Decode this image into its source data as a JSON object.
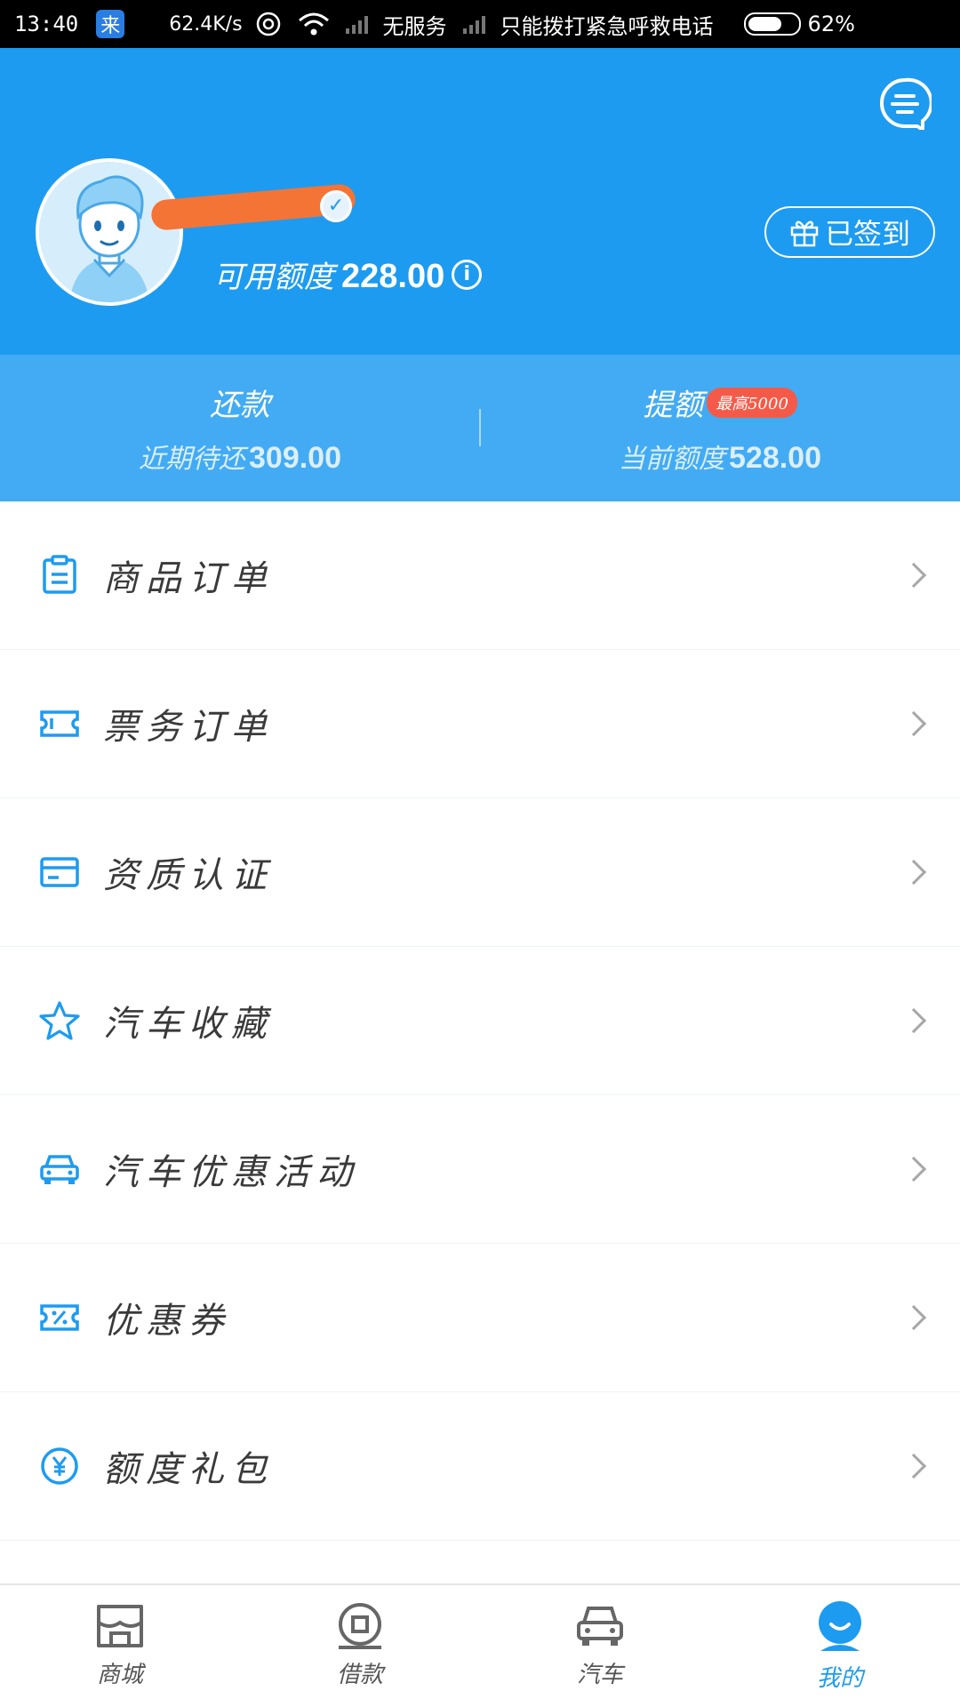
{
  "status_bar": {
    "time": "13:40",
    "app_icon_text": "来",
    "net_speed": "62.4K/s",
    "sim1_text": "无服务",
    "sim2_text": "只能拨打紧急呼救电话",
    "battery": "62%"
  },
  "header": {
    "username": "",
    "credit_label": "可用额度",
    "credit_value": "228.00",
    "signin_label": "已签到"
  },
  "sub": {
    "repay_title": "还款",
    "repay_detail_label": "近期待还",
    "repay_detail_value": "309.00",
    "withdraw_title": "提额",
    "withdraw_badge": "最高5000",
    "withdraw_detail_label": "当前额度",
    "withdraw_detail_value": "528.00"
  },
  "menu": {
    "items": [
      {
        "label": "商品订单",
        "icon": "clipboard-icon"
      },
      {
        "label": "票务订单",
        "icon": "ticket-icon"
      },
      {
        "label": "资质认证",
        "icon": "card-icon"
      },
      {
        "label": "汽车收藏",
        "icon": "star-icon"
      },
      {
        "label": "汽车优惠活动",
        "icon": "car-icon"
      },
      {
        "label": "优惠券",
        "icon": "coupon-icon"
      },
      {
        "label": "额度礼包",
        "icon": "yen-icon"
      }
    ]
  },
  "tabbar": {
    "tabs": [
      {
        "label": "商城",
        "icon": "shop-icon"
      },
      {
        "label": "借款",
        "icon": "loan-icon"
      },
      {
        "label": "汽车",
        "icon": "car-icon"
      },
      {
        "label": "我的",
        "icon": "profile-icon"
      }
    ],
    "active_index": 3
  },
  "colors": {
    "primary": "#1d9bf0",
    "sub_band": "#43abf3",
    "badge": "#f55a48",
    "redaction": "#f47436"
  }
}
